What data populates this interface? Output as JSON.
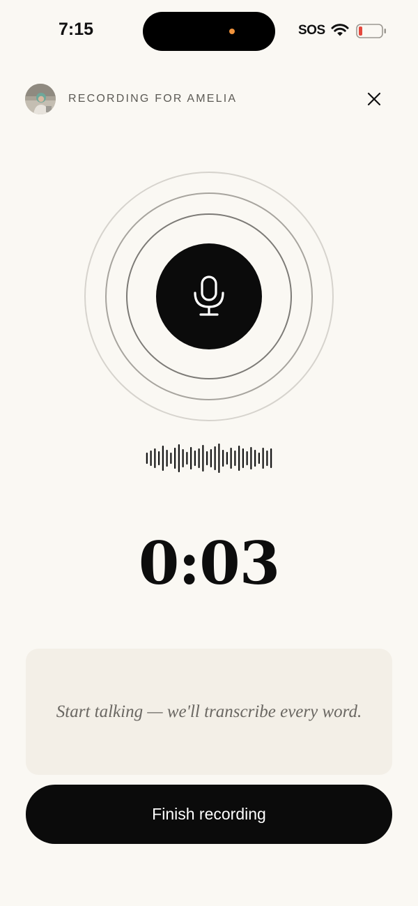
{
  "status_bar": {
    "time": "7:15",
    "carrier": "SOS",
    "indicator_color": "#f0933c",
    "battery_color": "#e5483d",
    "icons": [
      "wifi-icon",
      "battery-icon"
    ]
  },
  "header": {
    "label": "RECORDING FOR AMELIA",
    "avatar_icon": "avatar",
    "close_icon": "close-icon"
  },
  "recorder": {
    "mic_icon": "microphone-icon",
    "waveform_icon": "waveform-icon",
    "timer": "0:03"
  },
  "transcript": {
    "placeholder": "Start talking — we'll transcribe every word."
  },
  "actions": {
    "finish_label": "Finish recording"
  },
  "colors": {
    "background": "#faf8f3",
    "panel": "#f3efe7",
    "primary": "#0b0b0b"
  }
}
